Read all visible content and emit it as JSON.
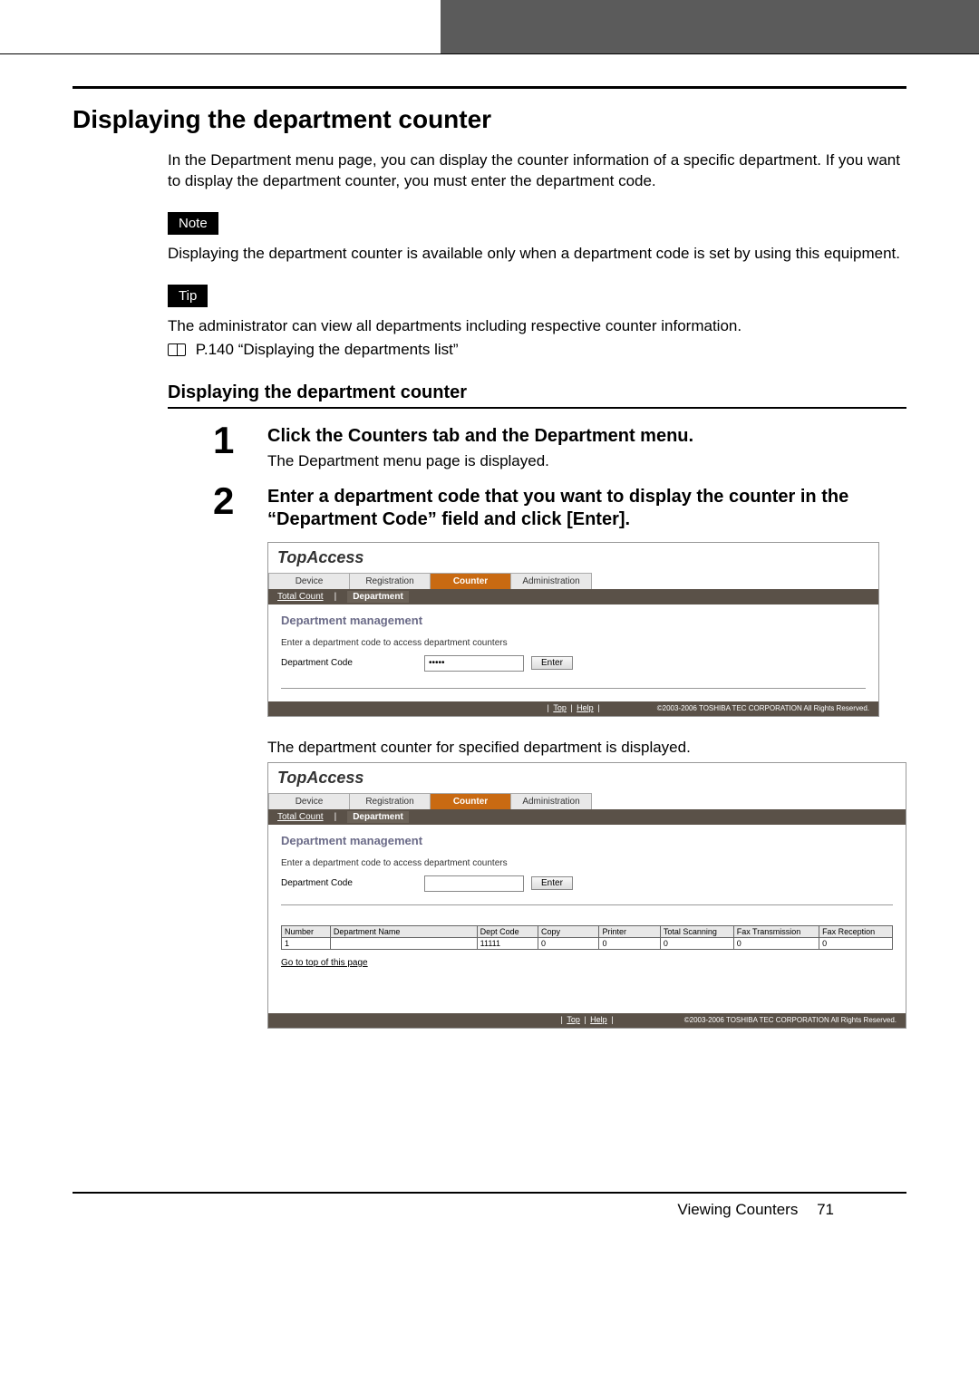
{
  "heading": "Displaying the department counter",
  "intro": "In the Department menu page, you can display the counter information of a specific department. If you want to display the department counter, you must enter the department code.",
  "note_badge": "Note",
  "note_text": "Displaying the department counter is available only when a department code is set by using this equipment.",
  "tip_badge": "Tip",
  "tip_text": "The administrator can view all departments including respective counter information.",
  "tip_ref": "P.140 “Displaying the departments list”",
  "subheading": "Displaying the department counter",
  "steps": [
    {
      "num": "1",
      "title": "Click the Counters tab and the Department menu.",
      "desc": "The Department menu page is displayed."
    },
    {
      "num": "2",
      "title": "Enter a department code that you want to display the counter in the “Department Code” field and click [Enter].",
      "desc": ""
    }
  ],
  "between_desc": "The department counter for specified department is displayed.",
  "shot": {
    "logo": "TopAccess",
    "tabs": [
      "Device",
      "Registration",
      "Counter",
      "Administration"
    ],
    "active_tab": 2,
    "subtabs": {
      "link": "Total Count",
      "active": "Department"
    },
    "panel_title": "Department management",
    "panel_sub": "Enter a department code to access department counters",
    "form_label": "Department Code",
    "input_value_masked": "•••••",
    "enter": "Enter",
    "footer_links": [
      "Top",
      "Help"
    ],
    "copyright": "©2003-2006 TOSHIBA TEC CORPORATION All Rights Reserved."
  },
  "table": {
    "headers": [
      "Number",
      "Department Name",
      "Dept Code",
      "Copy",
      "Printer",
      "Total Scanning",
      "Fax Transmission",
      "Fax Reception"
    ],
    "row": [
      "1",
      "",
      "11111",
      "0",
      "0",
      "0",
      "0",
      "0"
    ],
    "go_top": "Go to top of this page"
  },
  "footer": {
    "label": "Viewing Counters",
    "page": "71"
  }
}
